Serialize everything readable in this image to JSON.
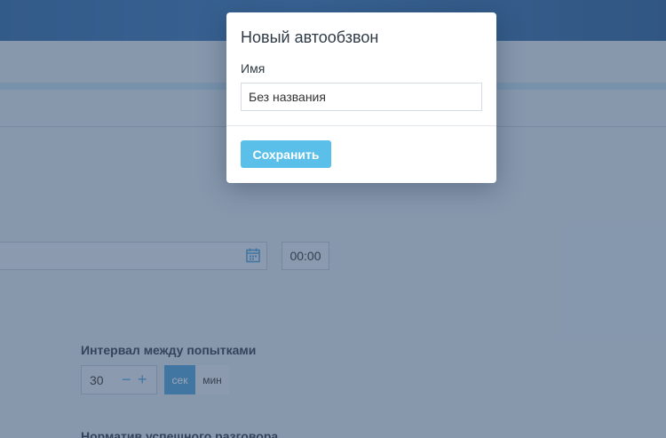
{
  "page": {
    "time_value": "00:00",
    "interval_label": "Интервал между попытками",
    "interval_value": "30",
    "minus_symbol": "−",
    "plus_symbol": "+",
    "unit_sec": "сек",
    "unit_min": "мин",
    "norm_label": "Норматив успешного разговора"
  },
  "modal": {
    "title": "Новый автообзвон",
    "name_label": "Имя",
    "name_value": "Без названия",
    "save_label": "Сохранить"
  },
  "colors": {
    "accent": "#4a9fd6",
    "save_button": "#5bc0e9",
    "header": "#3a78b8"
  },
  "icons": {
    "calendar": "calendar-icon"
  }
}
